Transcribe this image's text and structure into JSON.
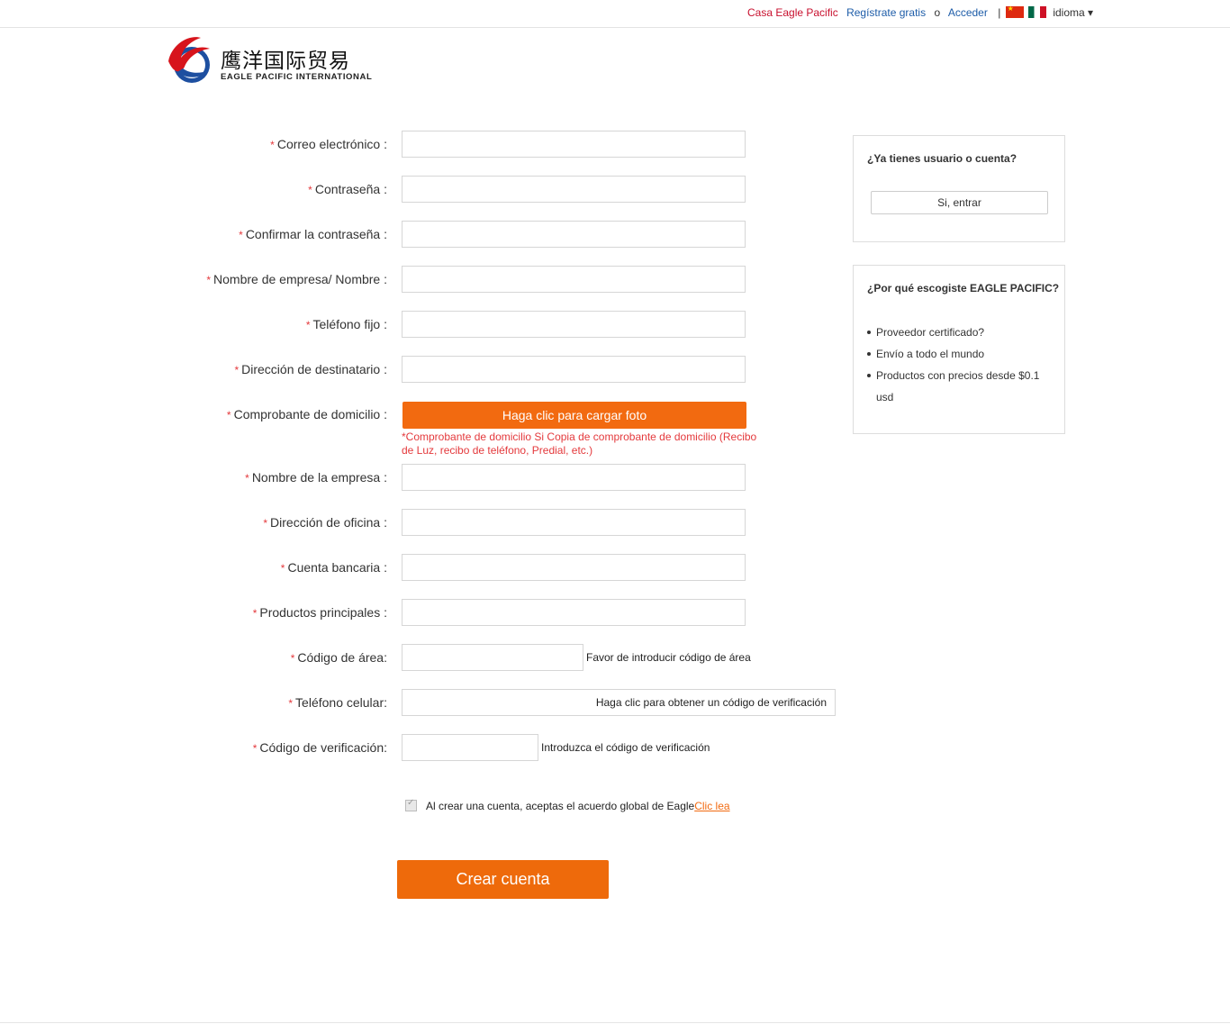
{
  "topbar": {
    "home": "Casa Eagle Pacific",
    "register": "Regístrate gratis",
    "or": "o",
    "login": "Acceder",
    "separator": "|",
    "language": "idioma ▾"
  },
  "logo": {
    "cn": "鹰洋国际贸易",
    "en": "EAGLE PACIFIC INTERNATIONAL"
  },
  "form": {
    "required_mark": "*",
    "email_label": "Correo electrónico :",
    "password_label": "Contraseña :",
    "confirm_label": "Confirmar la contraseña :",
    "company_name_label": "Nombre de empresa/ Nombre :",
    "landline_label": "Teléfono fijo :",
    "address_label": "Dirección de destinatario :",
    "proof_label": "Comprobante de domicilio :",
    "upload_button": "Haga clic para cargar foto",
    "upload_note": "*Comprobante de domicilio Si Copia de comprobante de domicilio (Recibo de Luz, recibo de teléfono, Predial, etc.)",
    "company_label": "Nombre de la empresa :",
    "office_label": "Dirección de oficina :",
    "bank_label": "Cuenta bancaria :",
    "products_label": "Productos principales :",
    "area_label": "Código de área:",
    "area_hint": "Favor de introducir código de área",
    "mobile_label": "Teléfono celular:",
    "get_code": "Haga clic para obtener un código de verificación",
    "verify_label": "Código de verificación:",
    "verify_hint": "Introduzca el código de verificación",
    "agree_text": "Al crear una cuenta, aceptas el acuerdo global de Eagle",
    "agree_link": "Clic lea",
    "submit": "Crear cuenta"
  },
  "sidebar": {
    "account_title": "¿Ya tienes usuario o cuenta?",
    "login_button": "Si, entrar",
    "why_title": "¿Por qué escogiste EAGLE PACIFIC?",
    "reasons": [
      "Proveedor certificado?",
      "Envío a todo el mundo",
      "Productos con precios desde $0.1 usd"
    ]
  }
}
